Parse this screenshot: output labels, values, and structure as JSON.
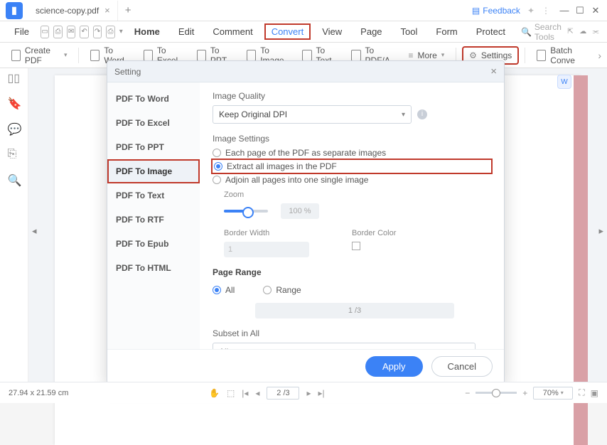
{
  "window": {
    "tab_title": "science-copy.pdf",
    "feedback": "Feedback"
  },
  "menu": {
    "file": "File",
    "home": "Home",
    "edit": "Edit",
    "comment": "Comment",
    "convert": "Convert",
    "view": "View",
    "page": "Page",
    "tool": "Tool",
    "form": "Form",
    "protect": "Protect",
    "search_placeholder": "Search Tools"
  },
  "toolbar": {
    "create_pdf": "Create PDF",
    "to_word": "To Word",
    "to_excel": "To Excel",
    "to_ppt": "To PPT",
    "to_image": "To Image",
    "to_text": "To Text",
    "to_pdfa": "To PDF/A",
    "more": "More",
    "settings": "Settings",
    "batch": "Batch Conve"
  },
  "modal": {
    "title": "Setting",
    "side": {
      "word": "PDF To Word",
      "excel": "PDF To Excel",
      "ppt": "PDF To PPT",
      "image": "PDF To Image",
      "text": "PDF To Text",
      "rtf": "PDF To RTF",
      "epub": "PDF To Epub",
      "html": "PDF To HTML"
    },
    "image_quality": {
      "label": "Image Quality",
      "value": "Keep Original DPI"
    },
    "image_settings_label": "Image Settings",
    "opt_each": "Each page of the PDF as separate images",
    "opt_extract": "Extract all images in the PDF",
    "opt_adjoin": "Adjoin all pages into one single image",
    "zoom_label": "Zoom",
    "zoom_value": "100 %",
    "border_width_label": "Border Width",
    "border_width_value": "1",
    "border_color_label": "Border Color",
    "page_range_label": "Page Range",
    "pr_all": "All",
    "pr_range": "Range",
    "range_display": "1 /3",
    "subset_label": "Subset in All",
    "subset_value": "All pages",
    "apply": "Apply",
    "cancel": "Cancel"
  },
  "status": {
    "dims": "27.94 x 21.59 cm",
    "page": "2 /3",
    "zoom": "70%"
  }
}
